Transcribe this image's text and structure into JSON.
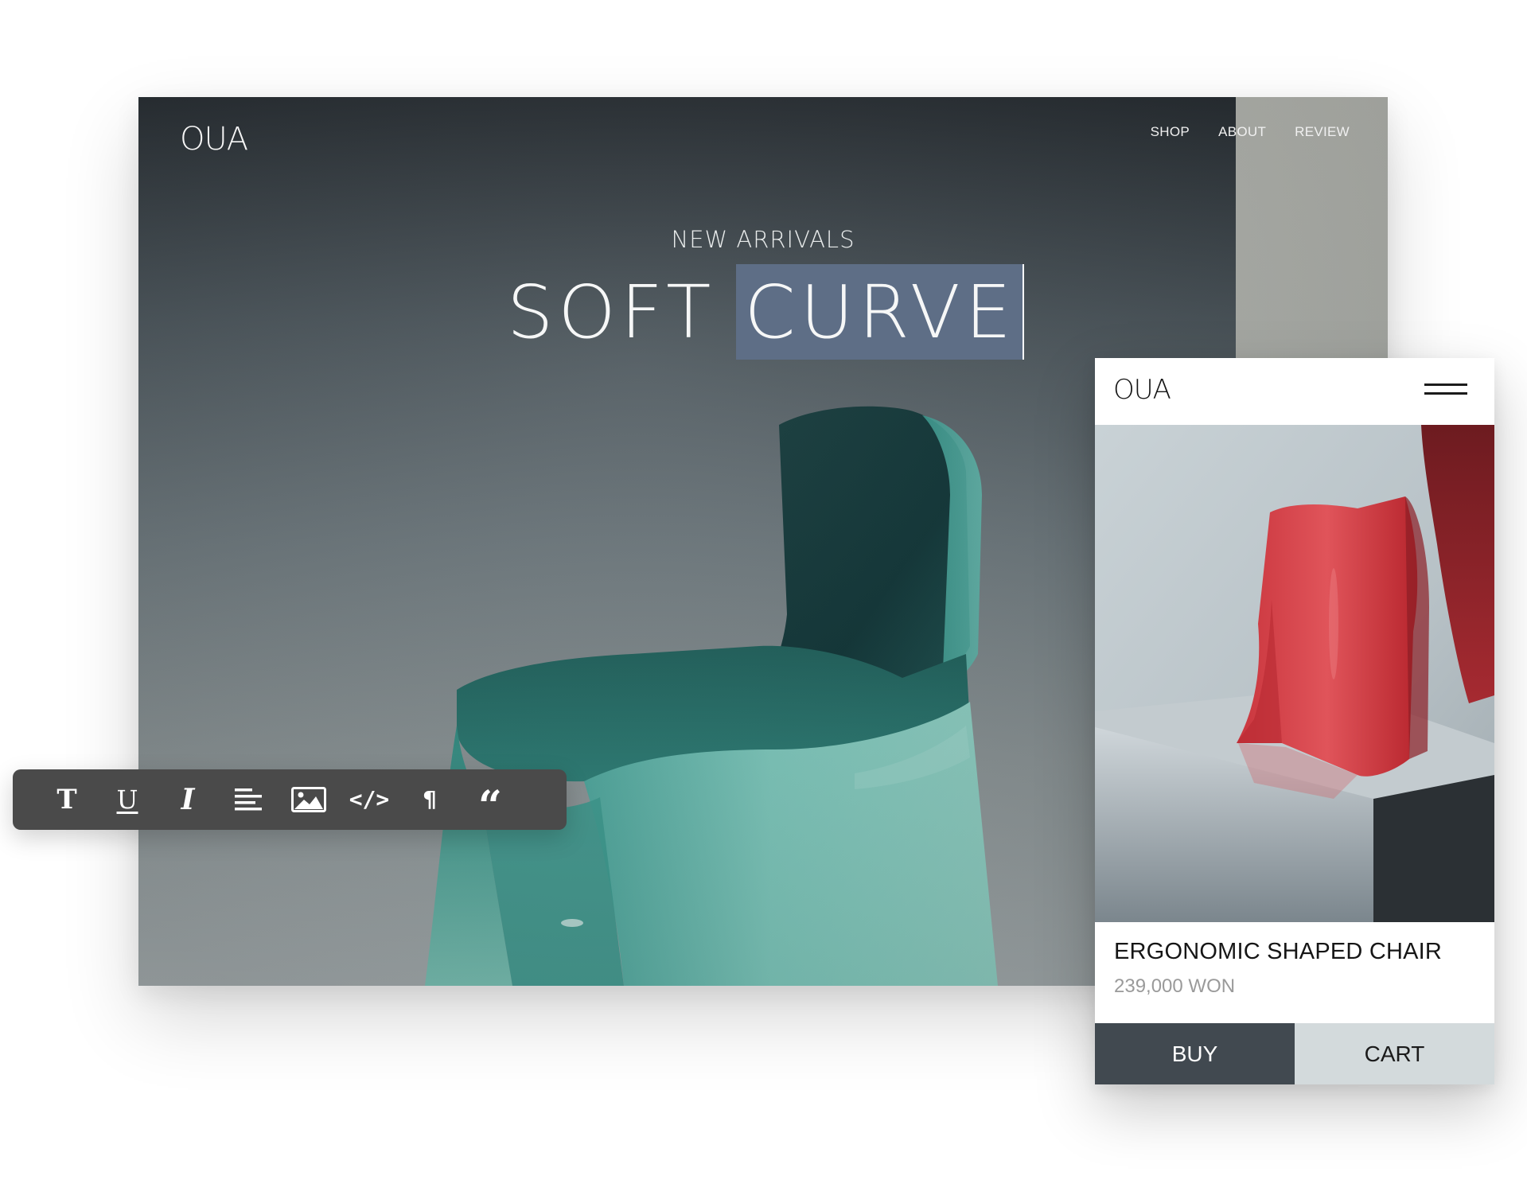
{
  "desktop": {
    "logo": "OUA",
    "nav": [
      "SHOP",
      "ABOUT",
      "REVIEW"
    ],
    "eyebrow": "NEW ARRIVALS",
    "headline_plain": "SOFT",
    "headline_selected": "CURVE"
  },
  "toolbar": {
    "tools": [
      {
        "name": "text-format-icon",
        "glyph": "T"
      },
      {
        "name": "underline-icon",
        "glyph": "U"
      },
      {
        "name": "italic-icon",
        "glyph": "I"
      },
      {
        "name": "align-left-icon",
        "glyph": ""
      },
      {
        "name": "image-icon",
        "glyph": ""
      },
      {
        "name": "code-icon",
        "glyph": "</>"
      },
      {
        "name": "paragraph-icon",
        "glyph": "¶"
      },
      {
        "name": "quote-icon",
        "glyph": "“"
      }
    ]
  },
  "mobile": {
    "logo": "OUA",
    "menu_icon": "hamburger-menu-icon",
    "product_title": "ERGONOMIC SHAPED CHAIR",
    "price": "239,000 WON",
    "buy_label": "BUY",
    "cart_label": "CART"
  },
  "colors": {
    "selection_highlight": "#5e6e86",
    "toolbar_bg": "#4a4a4a",
    "buy_button": "#414950",
    "cart_button": "#d3dadc",
    "teal_chair": "#5fb8ae",
    "red_chair": "#d6444b"
  }
}
